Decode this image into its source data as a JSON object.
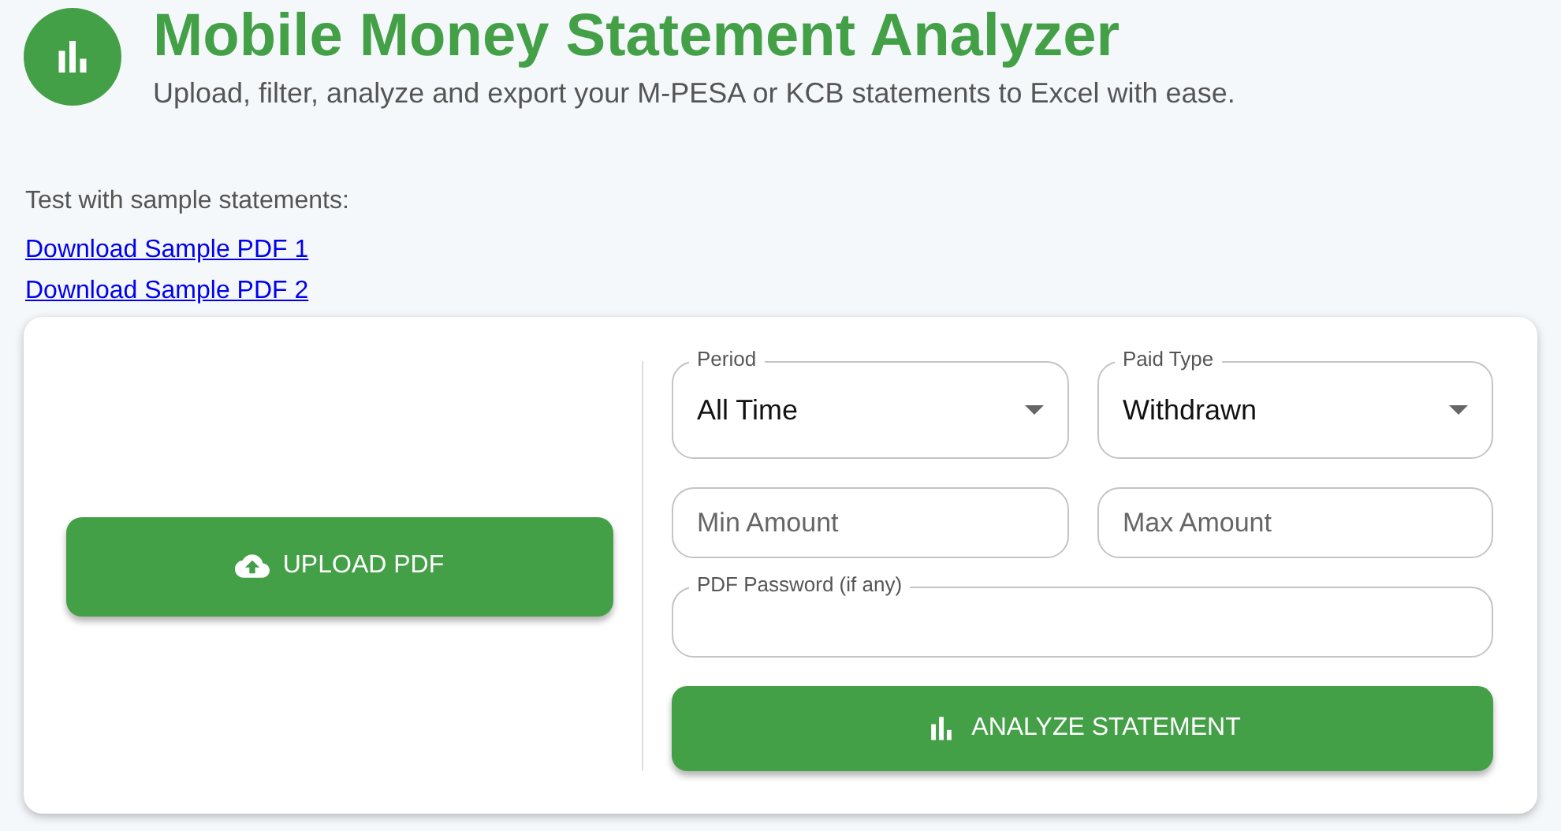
{
  "header": {
    "title": "Mobile Money Statement Analyzer",
    "subtitle": "Upload, filter, analyze and export your M-PESA or KCB statements to Excel with ease."
  },
  "samples": {
    "label": "Test with sample statements:",
    "links": [
      "Download Sample PDF 1",
      "Download Sample PDF 2"
    ]
  },
  "upload_button": {
    "label": "UPLOAD PDF"
  },
  "fields": [
    {
      "kind": "select",
      "label": "Period",
      "value": "All Time"
    },
    {
      "kind": "select",
      "label": "Paid Type",
      "value": "Withdrawn"
    },
    {
      "kind": "text",
      "placeholder": "Min Amount"
    },
    {
      "kind": "text",
      "placeholder": "Max Amount"
    },
    {
      "kind": "password",
      "label": "PDF Password (if any)"
    }
  ],
  "analyze_button": {
    "label": "ANALYZE STATEMENT"
  }
}
